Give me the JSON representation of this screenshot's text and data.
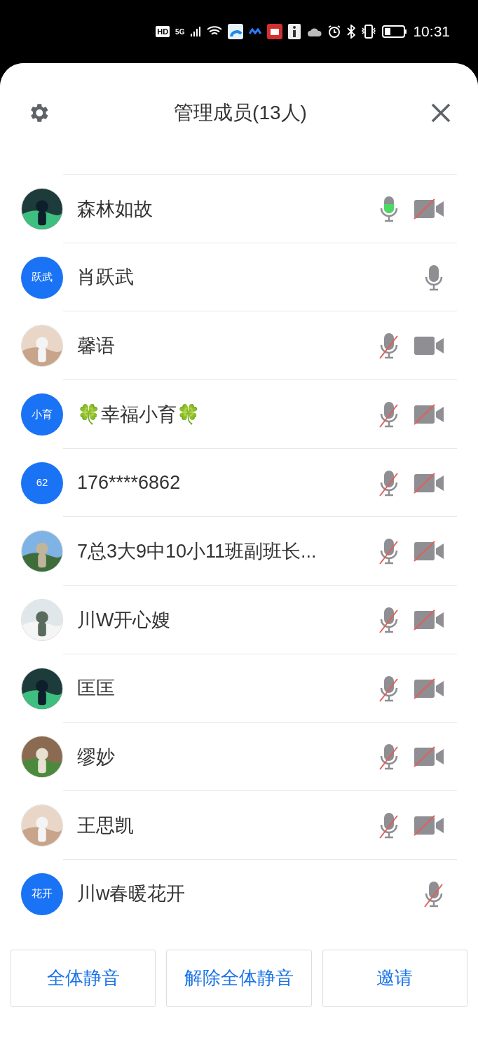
{
  "status_bar": {
    "badges": [
      "HD",
      "5G"
    ],
    "time": "10:31"
  },
  "header": {
    "title": "管理成员(13人)"
  },
  "members": [
    {
      "name": "森林如故",
      "mic": {
        "muted": false,
        "speaking": true
      },
      "camera": {
        "off": true
      }
    },
    {
      "name": "肖跃武",
      "avatar": {
        "kind": "initials",
        "text": "跃武"
      },
      "mic": {
        "muted": false,
        "speaking": false
      }
    },
    {
      "name": "馨语",
      "mic": {
        "muted": true,
        "speaking": false
      },
      "camera": {
        "off": false
      }
    },
    {
      "name": "🍀幸福小育🍀",
      "avatar": {
        "kind": "initials",
        "text": "小育"
      },
      "mic": {
        "muted": true,
        "speaking": false
      },
      "camera": {
        "off": true
      }
    },
    {
      "name": "176****6862",
      "avatar": {
        "kind": "initials",
        "text": "62"
      },
      "mic": {
        "muted": true,
        "speaking": false
      },
      "camera": {
        "off": true
      }
    },
    {
      "name": "7总3大9中10小11班副班长...",
      "mic": {
        "muted": true,
        "speaking": false
      },
      "camera": {
        "off": true
      }
    },
    {
      "name": "川W开心嫂",
      "mic": {
        "muted": true,
        "speaking": false
      },
      "camera": {
        "off": true
      }
    },
    {
      "name": "匡匡",
      "mic": {
        "muted": true,
        "speaking": false
      },
      "camera": {
        "off": true
      }
    },
    {
      "name": "缪妙",
      "mic": {
        "muted": true,
        "speaking": false
      },
      "camera": {
        "off": true
      }
    },
    {
      "name": "王思凯",
      "mic": {
        "muted": true,
        "speaking": false
      },
      "camera": {
        "off": true
      }
    },
    {
      "name": "川w春暖花开",
      "avatar": {
        "kind": "initials",
        "text": "花开"
      },
      "mic": {
        "muted": true,
        "speaking": false
      }
    }
  ],
  "buttons": [
    "全体静音",
    "解除全体静音",
    "邀请"
  ]
}
